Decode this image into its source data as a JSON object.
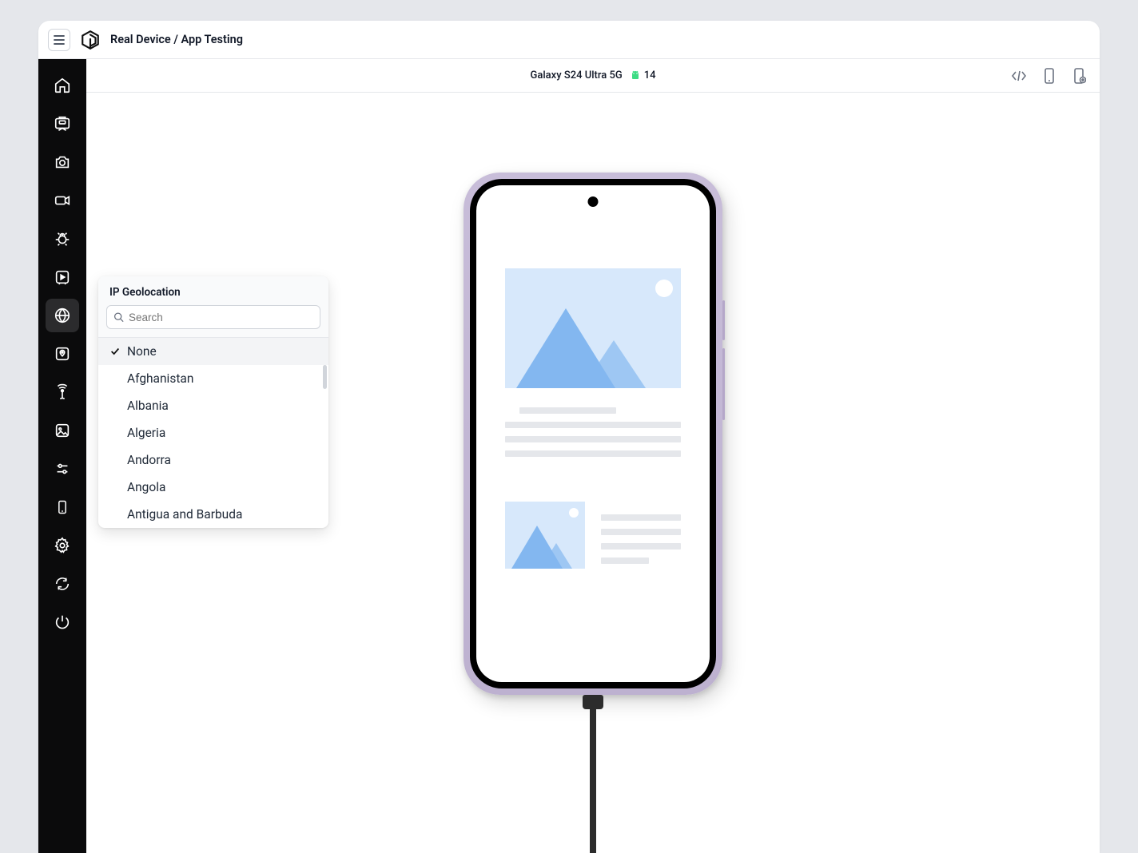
{
  "header": {
    "title": "Real Device / App Testing"
  },
  "deviceBar": {
    "device_name": "Galaxy S24 Ultra 5G",
    "os_version": "14"
  },
  "popover": {
    "title": "IP Geolocation",
    "search_placeholder": "Search",
    "items": [
      "None",
      "Afghanistan",
      "Albania",
      "Algeria",
      "Andorra",
      "Angola",
      "Antigua and Barbuda"
    ],
    "selected_index": 0
  },
  "sidebar": {
    "active_index": 6,
    "items": [
      "home",
      "app",
      "camera",
      "video",
      "bug",
      "play",
      "globe",
      "map-pin",
      "network",
      "image",
      "sliders",
      "device",
      "settings",
      "refresh",
      "power"
    ]
  }
}
